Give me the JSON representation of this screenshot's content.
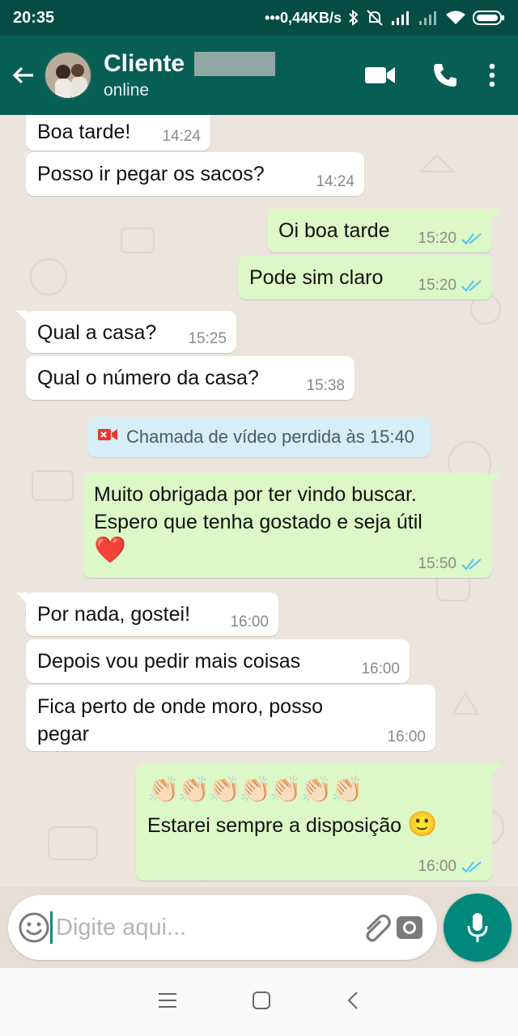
{
  "status_bar": {
    "time": "20:35",
    "network_speed": "•••0,44KB/s",
    "icons": [
      "bluetooth-icon",
      "mute-icon",
      "signal-icon",
      "signal-off-icon",
      "wifi-icon",
      "battery-icon"
    ]
  },
  "header": {
    "contact_name": "Cliente",
    "presence": "online",
    "icons": [
      "back-arrow-icon",
      "video-call-icon",
      "phone-call-icon",
      "more-options-icon"
    ]
  },
  "messages": [
    {
      "dir": "in",
      "text": "Boa tarde!",
      "time": "14:24"
    },
    {
      "dir": "in",
      "text": "Posso ir pegar os sacos?",
      "time": "14:24"
    },
    {
      "dir": "out",
      "text": "Oi boa tarde",
      "time": "15:20"
    },
    {
      "dir": "out",
      "text": "Pode sim claro",
      "time": "15:20"
    },
    {
      "dir": "in",
      "text": "Qual a casa?",
      "time": "15:25"
    },
    {
      "dir": "in",
      "text": "Qual o número da casa?",
      "time": "15:38"
    },
    {
      "dir": "out",
      "line1": "Muito obrigada por ter vindo buscar.",
      "line2": "Espero que tenha gostado e seja útil",
      "emoji": "❤️",
      "time": "15:50"
    },
    {
      "dir": "in",
      "text": "Por nada, gostei!",
      "time": "16:00"
    },
    {
      "dir": "in",
      "text": "Depois vou pedir mais coisas",
      "time": "16:00"
    },
    {
      "dir": "in",
      "line1": "Fica perto de onde moro, posso",
      "line2": "pegar",
      "time": "16:00"
    },
    {
      "dir": "out",
      "emojis": "👏🏻👏🏻👏🏻👏🏻👏🏻👏🏻👏🏻",
      "text": "Estarei sempre a disposição",
      "emoji": "🙂",
      "time": "16:00"
    }
  ],
  "system_notice": {
    "text": "Chamada de vídeo perdida às 15:40",
    "icon": "missed-video-call-icon"
  },
  "composer": {
    "placeholder": "Digite aqui...",
    "icons": [
      "emoji-icon",
      "attach-icon",
      "camera-icon",
      "mic-icon"
    ]
  },
  "nav_bar": {
    "icons": [
      "menu-icon",
      "home-icon",
      "back-icon"
    ]
  },
  "colors": {
    "header": "#075e54",
    "status_bar": "#054d44",
    "outgoing_bubble": "#dcf8c6",
    "incoming_bubble": "#ffffff",
    "read_ticks": "#4fc3f7",
    "mic_button": "#00897b"
  }
}
